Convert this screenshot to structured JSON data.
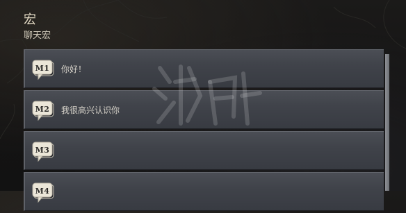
{
  "header": {
    "title": "宏",
    "subtitle": "聊天宏"
  },
  "macros": [
    {
      "badge": "M1",
      "text": "你好！"
    },
    {
      "badge": "M2",
      "text": "我很高兴认识你"
    },
    {
      "badge": "M3",
      "text": ""
    },
    {
      "badge": "M4",
      "text": ""
    }
  ],
  "colors": {
    "title": "#e2d9c4",
    "row_bg": "#42454c",
    "badge_fill": "#e9e4d6",
    "scroll_thumb": "#7d8085"
  },
  "icons": {
    "badge": "chat-bubble-icon",
    "watermark": "site-watermark-logo"
  }
}
